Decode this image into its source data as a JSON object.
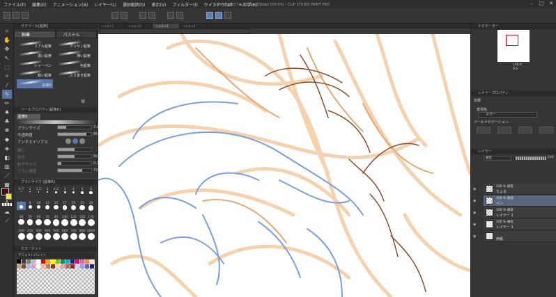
{
  "app": {
    "window_title": "イラスト2* (2917 x 3881px 350dpi 100.0%) - CLIP STUDIO PAINT PRO",
    "menu": [
      "ファイル(F)",
      "編集(E)",
      "アニメーション(A)",
      "レイヤー(L)",
      "選択範囲(S)",
      "表示(V)",
      "フィルター(I)",
      "ウィンドウ(W)",
      "ヘルプ(H)"
    ]
  },
  "subtool": {
    "panel_title": "サブツール[鉛筆]",
    "tabs": [
      "鉛筆",
      "パステル"
    ],
    "brushes": [
      "リアル鉛筆",
      "デッサン鉛筆",
      "濃い鉛筆",
      "薄い鉛筆",
      "シャーペン",
      "色鉛筆",
      "粗い鉛筆",
      "入り抜き鉛筆",
      "鉛筆R"
    ]
  },
  "tool_property": {
    "title": "ツールプロパティ[鉛筆R]",
    "brush_name": "鉛筆R",
    "props": [
      {
        "label": "ブラシサイズ",
        "value": "7.0",
        "fill": 0.25
      },
      {
        "label": "不透明度",
        "value": "85",
        "fill": 0.85
      },
      {
        "label": "アンチエイリアス",
        "value": "",
        "fill": 0
      },
      {
        "label": "硬さ",
        "value": "",
        "fill": 0.5
      },
      {
        "label": "粒子",
        "value": "50",
        "fill": 0.5
      },
      {
        "label": "粒子サイズ",
        "value": "0.3",
        "fill": 0.1
      },
      {
        "label": "ブラシ濃度",
        "value": "73",
        "fill": 0.73
      }
    ]
  },
  "brush_size": {
    "title": "ブラシサイズ [鉛筆R]",
    "labels": [
      "0.7",
      "1",
      "1.5",
      "2",
      "2.5",
      "3",
      "4",
      "5",
      "6",
      "7",
      "8",
      "10",
      "12",
      "15",
      "17",
      "20",
      "25",
      "30",
      "40",
      "50",
      "60",
      "70",
      "80",
      "100",
      "120",
      "150",
      "170",
      "200",
      "250",
      "300",
      "400",
      "500",
      "600",
      "700",
      "800",
      "1000"
    ]
  },
  "palette": {
    "title": "カラーセット",
    "subtitle": "デフォルトパレット",
    "colors": [
      "#000",
      "#3c3c3c",
      "#7d7d7d",
      "#bdbdbd",
      "#fff",
      "#e50012",
      "#f6ab00",
      "#fff100",
      "#8fc31f",
      "#009944",
      "#00a0e9",
      "#1d2088",
      "#e4007f",
      "#ea68a2",
      "#f19149",
      "#ffe4c4",
      "#c0a080",
      "#7a4c2c",
      "#a0c0e0",
      "#e0a0c0",
      "#ffffff",
      "#e8c0a0",
      "#c08060",
      "#804020",
      "#ffd0d0",
      "#f0a0a0",
      "#c06060",
      "#a02020",
      "#d0d0ff",
      "#a0a0e0",
      "#6060c0",
      "#202080"
    ]
  },
  "colors": {
    "main": "#4d0a0a",
    "sub": "#ffec00",
    "accent": "#5877a8"
  },
  "doc_tabs": [
    "イラスト1",
    "イラスト2",
    "イラスト3",
    "イラスト4"
  ],
  "navigator": {
    "title": "ナビゲーター",
    "zoom": "100.0",
    "rotate": "0.0"
  },
  "layer_property": {
    "title": "レイヤープロパティ",
    "effect": "効果",
    "expression_label": "表現色",
    "expression_value": "カラー",
    "tool_nav": "ツールナビゲーション"
  },
  "layers": {
    "title": "レイヤー",
    "blend": "通常",
    "opacity": "100",
    "items": [
      {
        "mode": "100 % 通常",
        "name": "ちょる"
      },
      {
        "mode": "100 % 通常",
        "name": "ペン"
      },
      {
        "mode": "100 % 通常",
        "name": "レイヤー 2"
      },
      {
        "mode": "100 % 通常",
        "name": "レイヤー 1"
      },
      {
        "mode": "",
        "name": "用紙"
      }
    ]
  }
}
